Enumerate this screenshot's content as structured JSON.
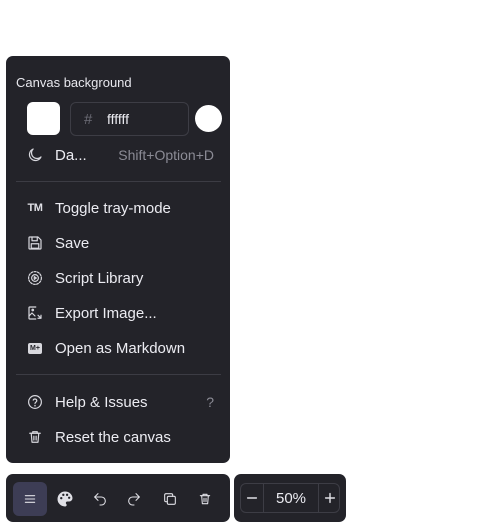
{
  "menu": {
    "section_title": "Canvas background",
    "background_color": "#ffffff",
    "hex_prefix": "#",
    "hex_value": "ffffff",
    "theme_item": {
      "label": "Da...",
      "shortcut": "Shift+Option+D",
      "icon": "moon-icon"
    },
    "items": [
      {
        "label": "Toggle tray-mode",
        "icon": "tm-icon"
      },
      {
        "label": "Save",
        "icon": "save-icon"
      },
      {
        "label": "Script Library",
        "icon": "script-library-icon"
      },
      {
        "label": "Export Image...",
        "icon": "export-image-icon"
      },
      {
        "label": "Open as Markdown",
        "icon": "markdown-icon"
      }
    ],
    "help": {
      "label": "Help & Issues",
      "shortcut": "?",
      "icon": "help-icon"
    },
    "reset": {
      "label": "Reset the canvas",
      "icon": "trash-icon"
    },
    "tm_glyph": "TM",
    "md_glyph": "M+"
  },
  "toolbar": {
    "buttons": [
      "menu-icon",
      "palette-icon",
      "undo-icon",
      "redo-icon",
      "duplicate-icon",
      "trash-icon"
    ]
  },
  "zoom": {
    "value": "50%"
  },
  "colors": {
    "panel": "#232329",
    "accent": "#3d3d55"
  }
}
